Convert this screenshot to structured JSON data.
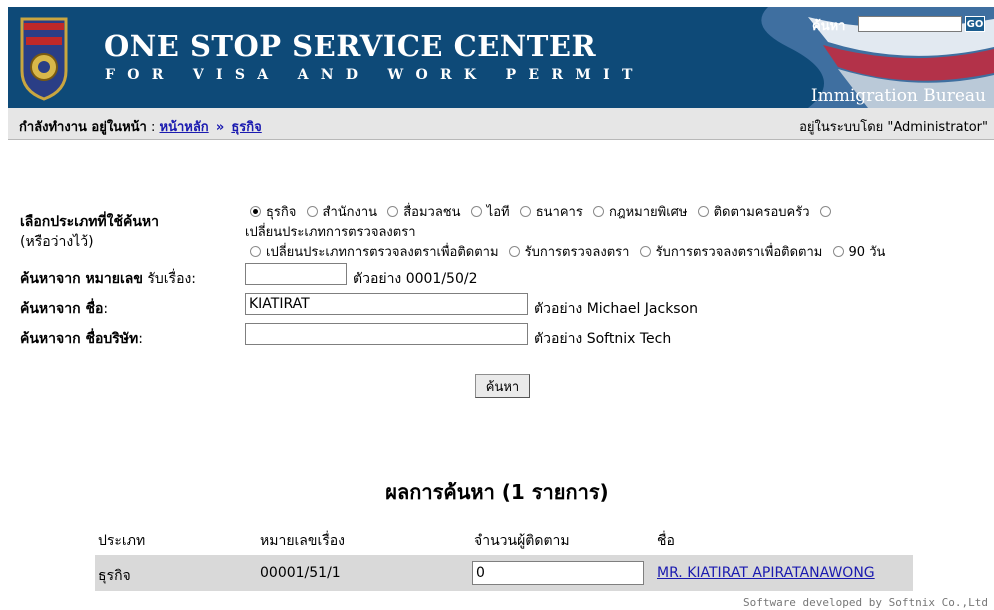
{
  "header": {
    "title_line1": "ONE STOP SERVICE CENTER",
    "title_line2": "FOR VISA AND WORK PERMIT",
    "bureau": "Immigration Bureau",
    "badge_icon": "royal-thai-police-immigration-badge",
    "search_label": "ค้นหา",
    "search_value": "",
    "go_label": "GO",
    "colors": {
      "bar": "#0e4a78",
      "link": "#1a1ab0"
    }
  },
  "breadcrumb": {
    "lead": "กำลังทำงาน อยู่ในหน้า",
    "home": "หน้าหลัก",
    "separator": "»",
    "current": "ธุรกิจ",
    "logged_in": "อยู่ในระบบโดย \"Administrator\""
  },
  "form": {
    "type_label": "เลือกประเภทที่ใช้ค้นหา",
    "type_sublabel": "(หรือว่างไว้)",
    "types": [
      {
        "label": "ธุรกิจ",
        "selected": true
      },
      {
        "label": "สำนักงาน",
        "selected": false
      },
      {
        "label": "สื่อมวลชน",
        "selected": false
      },
      {
        "label": "ไอที",
        "selected": false
      },
      {
        "label": "ธนาคาร",
        "selected": false
      },
      {
        "label": "กฎหมายพิเศษ",
        "selected": false
      },
      {
        "label": "ติดตามครอบครัว",
        "selected": false
      },
      {
        "label": "เปลี่ยนประเภทการตรวจลงตรา",
        "selected": false
      },
      {
        "label": "เปลี่ยนประเภทการตรวจลงตราเพื่อติดตาม",
        "selected": false
      },
      {
        "label": "รับการตรวจลงตรา",
        "selected": false
      },
      {
        "label": "รับการตรวจลงตราเพื่อติดตาม",
        "selected": false
      },
      {
        "label": "90 วัน",
        "selected": false
      }
    ],
    "case_label_bold": "ค้นหาจาก หมายเลข",
    "case_label_rest": " รับเรื่อง:",
    "case_value": "",
    "case_hint": "ตัวอย่าง 0001/50/2",
    "name_label_bold": "ค้นหาจาก ชื่อ",
    "name_label_rest": ":",
    "name_value": "KIATIRAT",
    "name_hint": "ตัวอย่าง Michael Jackson",
    "company_label_bold": "ค้นหาจาก ชื่อบริษัท",
    "company_label_rest": ":",
    "company_value": "",
    "company_hint": "ตัวอย่าง Softnix Tech",
    "search_button": "ค้นหา"
  },
  "results": {
    "title": "ผลการค้นหา (1 รายการ)",
    "columns": [
      "ประเภท",
      "หมายเลขเรื่อง",
      "จำนวนผู้ติดตาม",
      "ชื่อ"
    ],
    "rows": [
      {
        "type": "ธุรกิจ",
        "case_no": "00001/51/1",
        "followers": "0",
        "name": "MR. KIATIRAT APIRATANAWONG"
      }
    ]
  },
  "footer": "Software developed by Softnix Co.,Ltd"
}
